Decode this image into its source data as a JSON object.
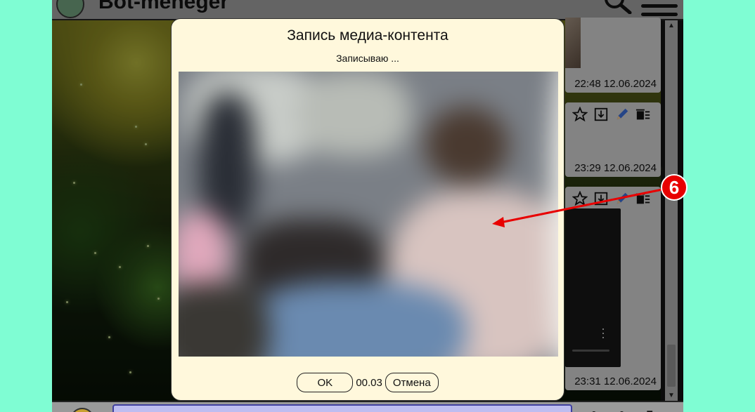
{
  "app": {
    "title": "Bot-meneger"
  },
  "messages": [
    {
      "time": "22:48 12.06.2024"
    },
    {
      "time": "23:29 12.06.2024"
    },
    {
      "time": "23:31 12.06.2024"
    }
  ],
  "modal": {
    "title": "Запись медиа-контента",
    "status": "Записываю ...",
    "ok_label": "OK",
    "timer": "00.03",
    "cancel_label": "Отмена"
  },
  "annotation": {
    "badge_number": "6"
  },
  "colors": {
    "page_bg": "#7ffdd3",
    "modal_bg": "#fff8dc",
    "badge": "#e80000",
    "arrow": "#e80000"
  }
}
